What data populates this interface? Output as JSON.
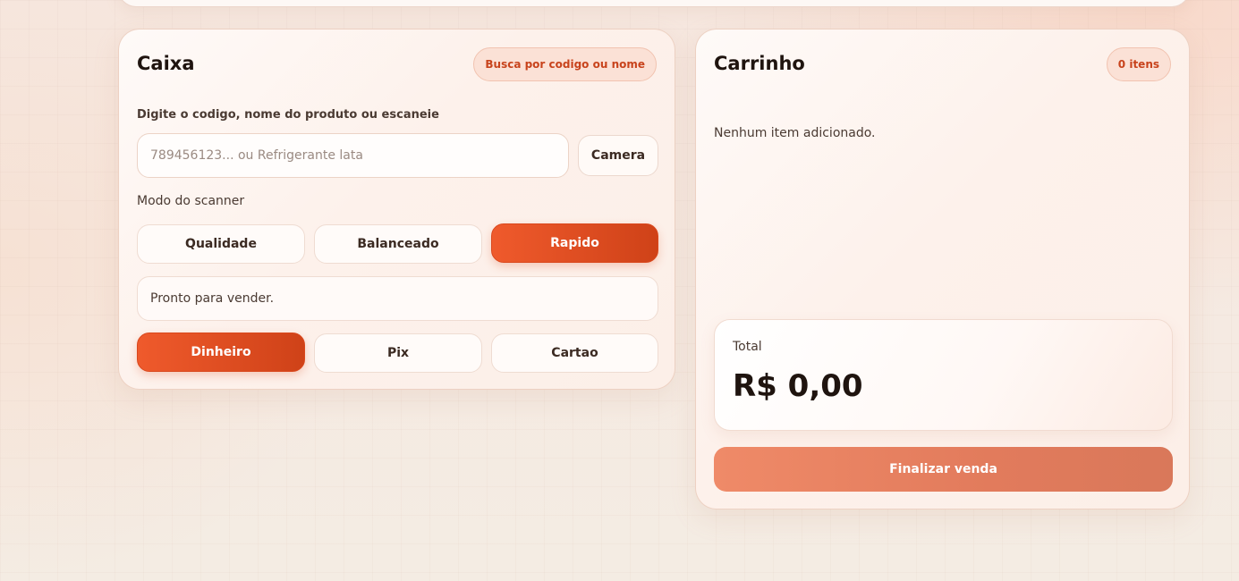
{
  "caixa": {
    "title": "Caixa",
    "badge": "Busca por codigo ou nome",
    "input_label": "Digite o codigo, nome do produto ou escaneie",
    "search_placeholder": "789456123... ou Refrigerante lata",
    "search_value": "",
    "camera_label": "Camera",
    "scanner_mode_label": "Modo do scanner",
    "scanner_modes": [
      {
        "label": "Qualidade",
        "active": false
      },
      {
        "label": "Balanceado",
        "active": false
      },
      {
        "label": "Rapido",
        "active": true
      }
    ],
    "status": "Pronto para vender.",
    "payment_methods": [
      {
        "label": "Dinheiro",
        "active": true
      },
      {
        "label": "Pix",
        "active": false
      },
      {
        "label": "Cartao",
        "active": false
      }
    ]
  },
  "carrinho": {
    "title": "Carrinho",
    "badge": "0 itens",
    "empty_message": "Nenhum item adicionado.",
    "total_label": "Total",
    "total_value": "R$ 0,00",
    "finalize_label": "Finalizar venda"
  },
  "colors": {
    "accent": "#e14e22",
    "accent_soft": "#ef8a68",
    "badge_bg": "#fbe1d6",
    "badge_text": "#c8431c"
  }
}
